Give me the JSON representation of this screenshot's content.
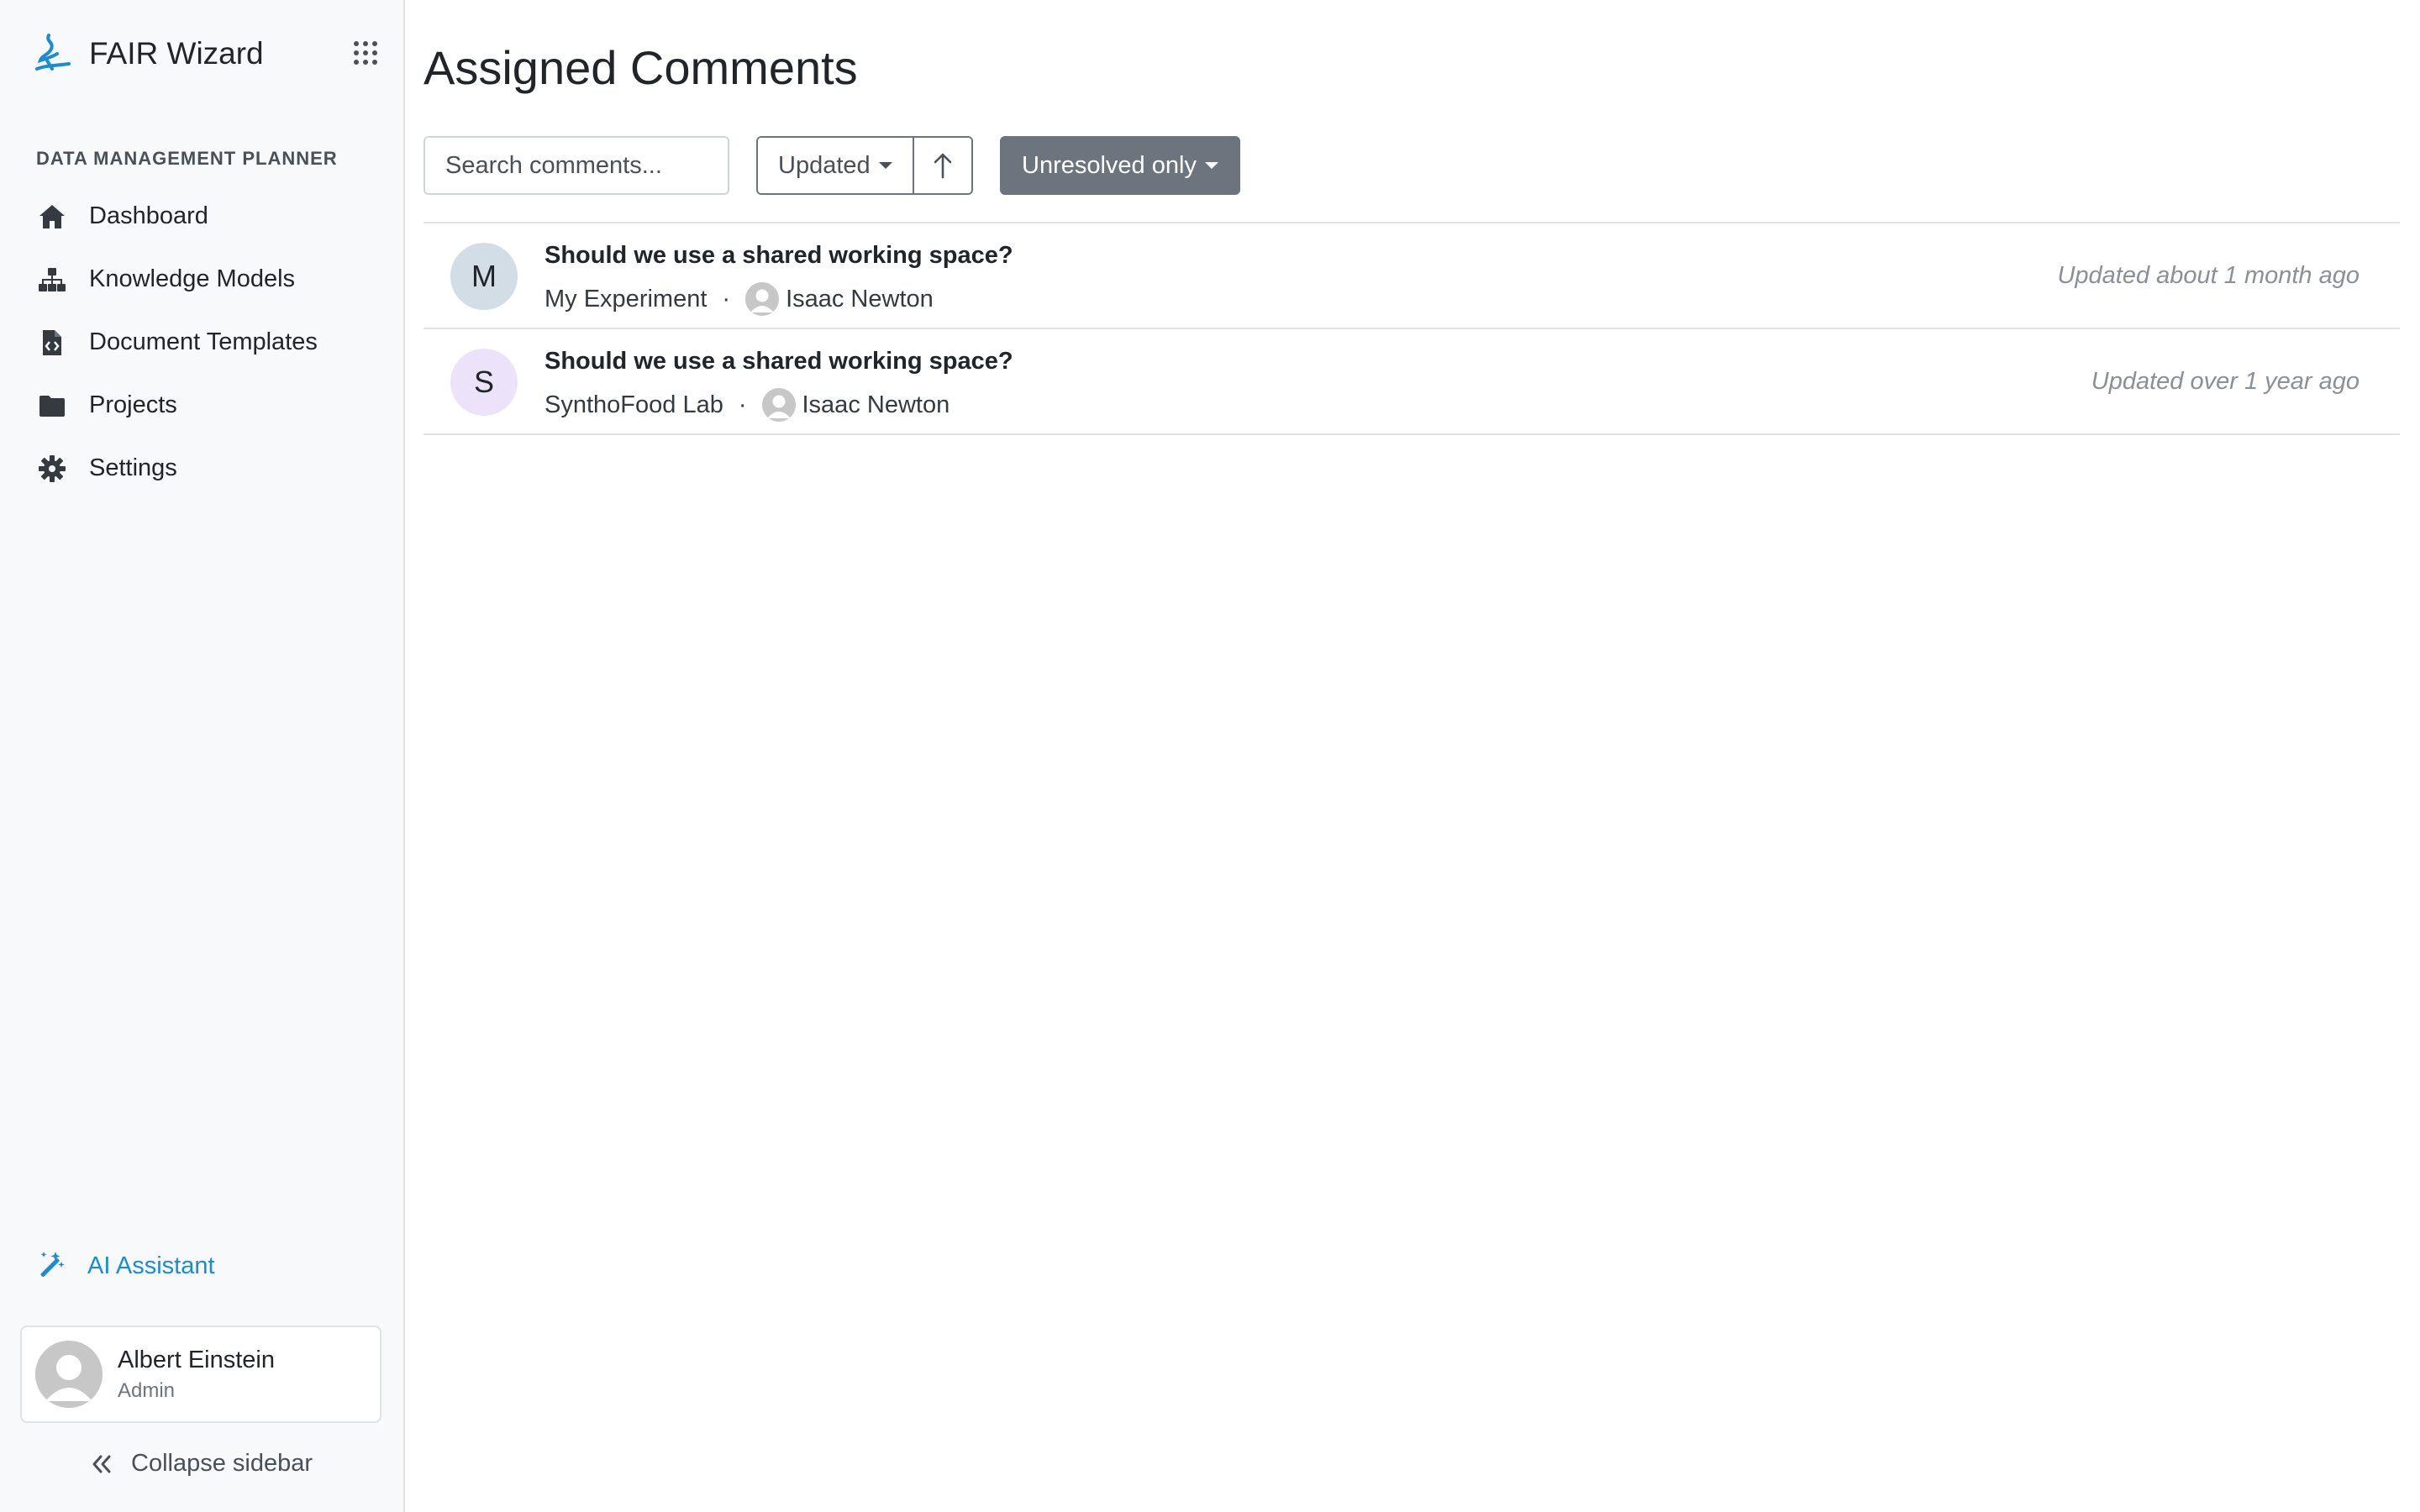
{
  "app": {
    "name": "FAIR Wizard",
    "brand_color": "#1b8bd3"
  },
  "sidebar": {
    "section_label": "DATA MANAGEMENT PLANNER",
    "items": [
      {
        "label": "Dashboard",
        "icon": "home-icon"
      },
      {
        "label": "Knowledge Models",
        "icon": "sitemap-icon"
      },
      {
        "label": "Document Templates",
        "icon": "file-code-icon"
      },
      {
        "label": "Projects",
        "icon": "folder-icon"
      },
      {
        "label": "Settings",
        "icon": "gear-icon"
      }
    ],
    "ai_assistant": {
      "label": "AI Assistant",
      "icon": "magic-wand-icon"
    },
    "user": {
      "name": "Albert Einstein",
      "role": "Admin"
    },
    "collapse_label": "Collapse sidebar"
  },
  "main": {
    "title": "Assigned Comments",
    "search": {
      "placeholder": "Search comments..."
    },
    "sort": {
      "label": "Updated",
      "direction": "ascending"
    },
    "filter": {
      "label": "Unresolved only"
    },
    "comments": [
      {
        "initial": "M",
        "avatar_color": "#d3dde6",
        "title": "Should we use a shared working space?",
        "project": "My Experiment",
        "assignee": "Isaac Newton",
        "updated": "Updated about 1 month ago"
      },
      {
        "initial": "S",
        "avatar_color": "#ece3fb",
        "title": "Should we use a shared working space?",
        "project": "SynthoFood Lab",
        "assignee": "Isaac Newton",
        "updated": "Updated over 1 year ago"
      }
    ]
  }
}
